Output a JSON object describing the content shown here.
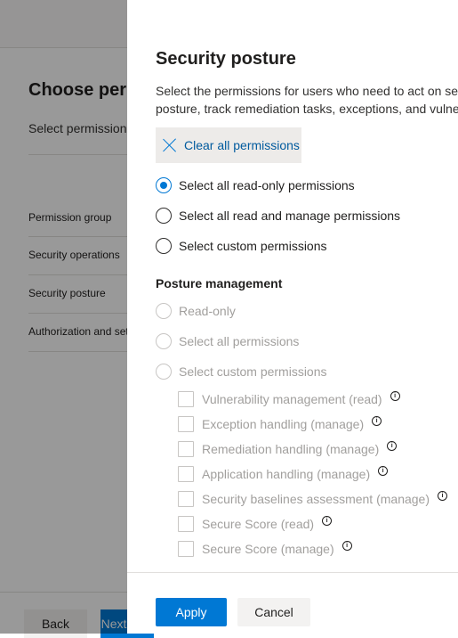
{
  "background": {
    "title": "Choose permissions",
    "subtitle": "Select permissions",
    "nav": [
      "Permission group",
      "Security operations",
      "Security posture",
      "Authorization and settings"
    ],
    "back_label": "Back",
    "next_label": "Next"
  },
  "panel": {
    "title": "Security posture",
    "description": "Select the permissions for users who need to act on security posture, track remediation tasks, exceptions, and vulnerabilities.",
    "clear_label": "Clear all permissions",
    "options": [
      "Select all read-only permissions",
      "Select all read and manage permissions",
      "Select custom permissions"
    ],
    "selected_option": 0,
    "section_title": "Posture management",
    "section_options": [
      "Read-only",
      "Select all permissions",
      "Select custom permissions"
    ],
    "permissions": [
      "Vulnerability management (read)",
      "Exception handling (manage)",
      "Remediation handling (manage)",
      "Application handling (manage)",
      "Security baselines assessment (manage)",
      "Secure Score (read)",
      "Secure Score (manage)"
    ],
    "info_glyph": "i",
    "apply_label": "Apply",
    "cancel_label": "Cancel"
  },
  "colors": {
    "accent": "#0078d4",
    "disabled": "#a19f9d",
    "overlay": "rgba(0,0,0,0.4)"
  }
}
